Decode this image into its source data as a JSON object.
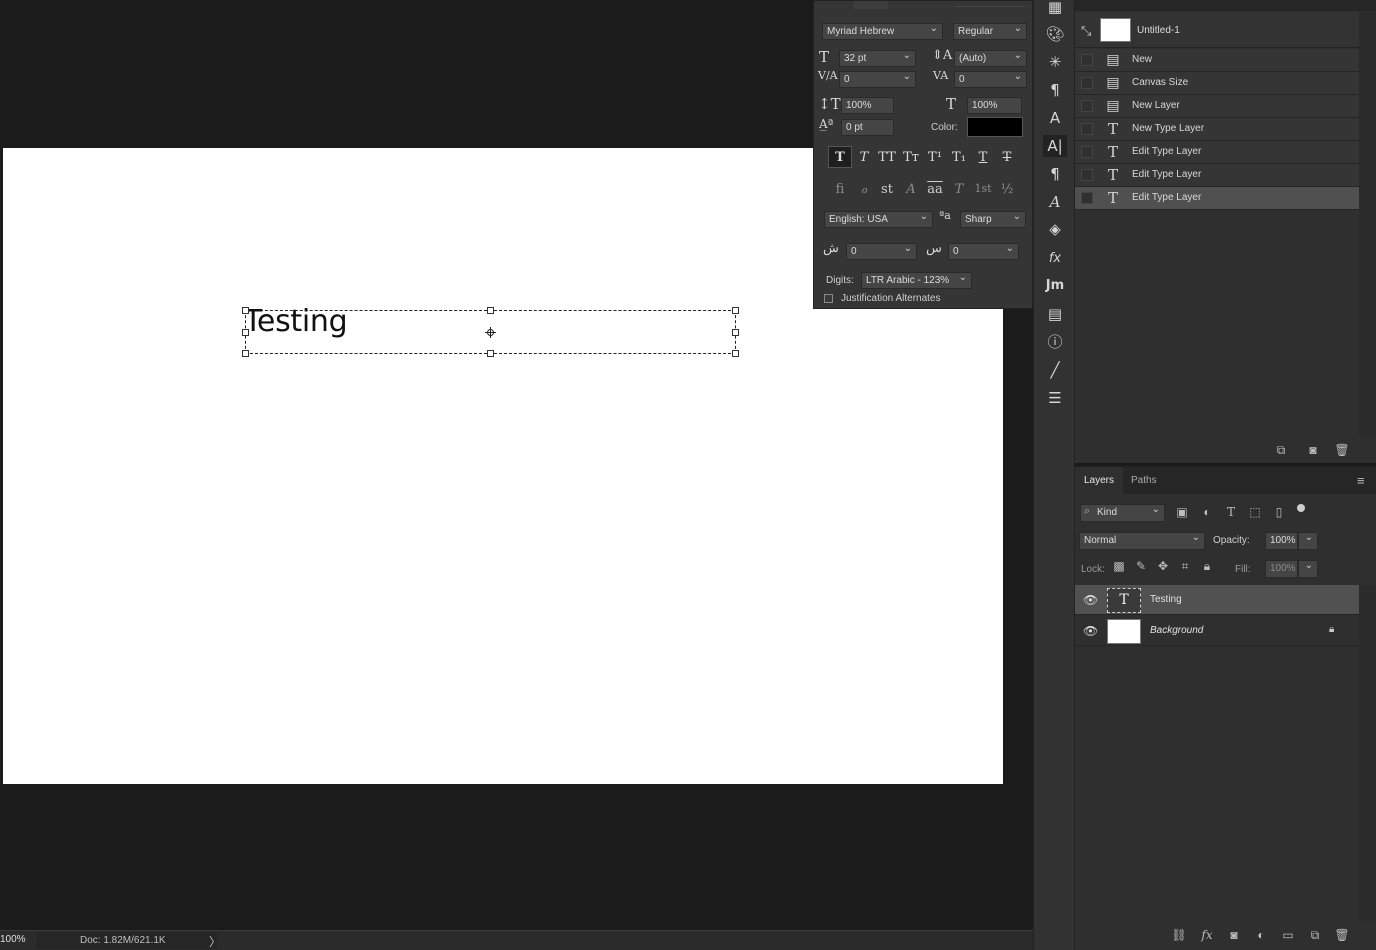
{
  "status_bar": {
    "zoom": "100%",
    "doc_info": "Doc: 1.82M/621.1K",
    "arrow": "〉"
  },
  "canvas": {
    "text_layer_content": "Testing",
    "background": "#ffffff"
  },
  "character_panel": {
    "font_family": "Myriad Hebrew",
    "font_style": "Regular",
    "font_size": "32 pt",
    "leading": "(Auto)",
    "kerning": "0",
    "tracking": "0",
    "vertical_scale": "100%",
    "horizontal_scale": "100%",
    "baseline_shift": "0 pt",
    "color_label": "Color:",
    "color_value": "#000000",
    "language": "English: USA",
    "antialias": "Sharp",
    "arabic_spacing_1": "0",
    "arabic_spacing_2": "0",
    "digits_label": "Digits:",
    "digits_value": "LTR Arabic - 123%",
    "justification_label": "Justification Alternates",
    "style_buttons": [
      "T",
      "T",
      "TT",
      "Tт",
      "T¹",
      "T₁",
      "T",
      "T"
    ],
    "opentype_buttons": [
      "fi",
      "ℴ",
      "st",
      "A",
      "aa",
      "T",
      "1st",
      "½"
    ]
  },
  "history": {
    "snapshot_name": "Untitled-1",
    "items": [
      {
        "label": "New",
        "icon": "document-icon"
      },
      {
        "label": "Canvas Size",
        "icon": "document-icon"
      },
      {
        "label": "New Layer",
        "icon": "document-icon"
      },
      {
        "label": "New Type Layer",
        "icon": "type-icon"
      },
      {
        "label": "Edit Type Layer",
        "icon": "type-icon"
      },
      {
        "label": "Edit Type Layer",
        "icon": "type-icon"
      },
      {
        "label": "Edit Type Layer",
        "icon": "type-icon"
      }
    ]
  },
  "layers": {
    "tabs": [
      "Layers",
      "Paths"
    ],
    "filter_kind": "Kind",
    "blend_mode": "Normal",
    "opacity_label": "Opacity:",
    "opacity_value": "100%",
    "lock_label": "Lock:",
    "fill_label": "Fill:",
    "fill_value": "100%",
    "rows": [
      {
        "name": "Testing",
        "type": "text",
        "thumb_glyph": "T"
      },
      {
        "name": "Background",
        "type": "raster"
      }
    ]
  },
  "tool_strip": {
    "tools": [
      "grid-icon",
      "palette-icon",
      "compass-icon",
      "paragraph-style-icon",
      "character-style-icon",
      "character-icon",
      "paragraph-icon",
      "glyphs-icon",
      "3d-icon",
      "fx-icon",
      "jm-icon",
      "notes-icon",
      "info-icon",
      "brush-icon",
      "adjustments-icon"
    ],
    "jm_label": "Jm"
  }
}
